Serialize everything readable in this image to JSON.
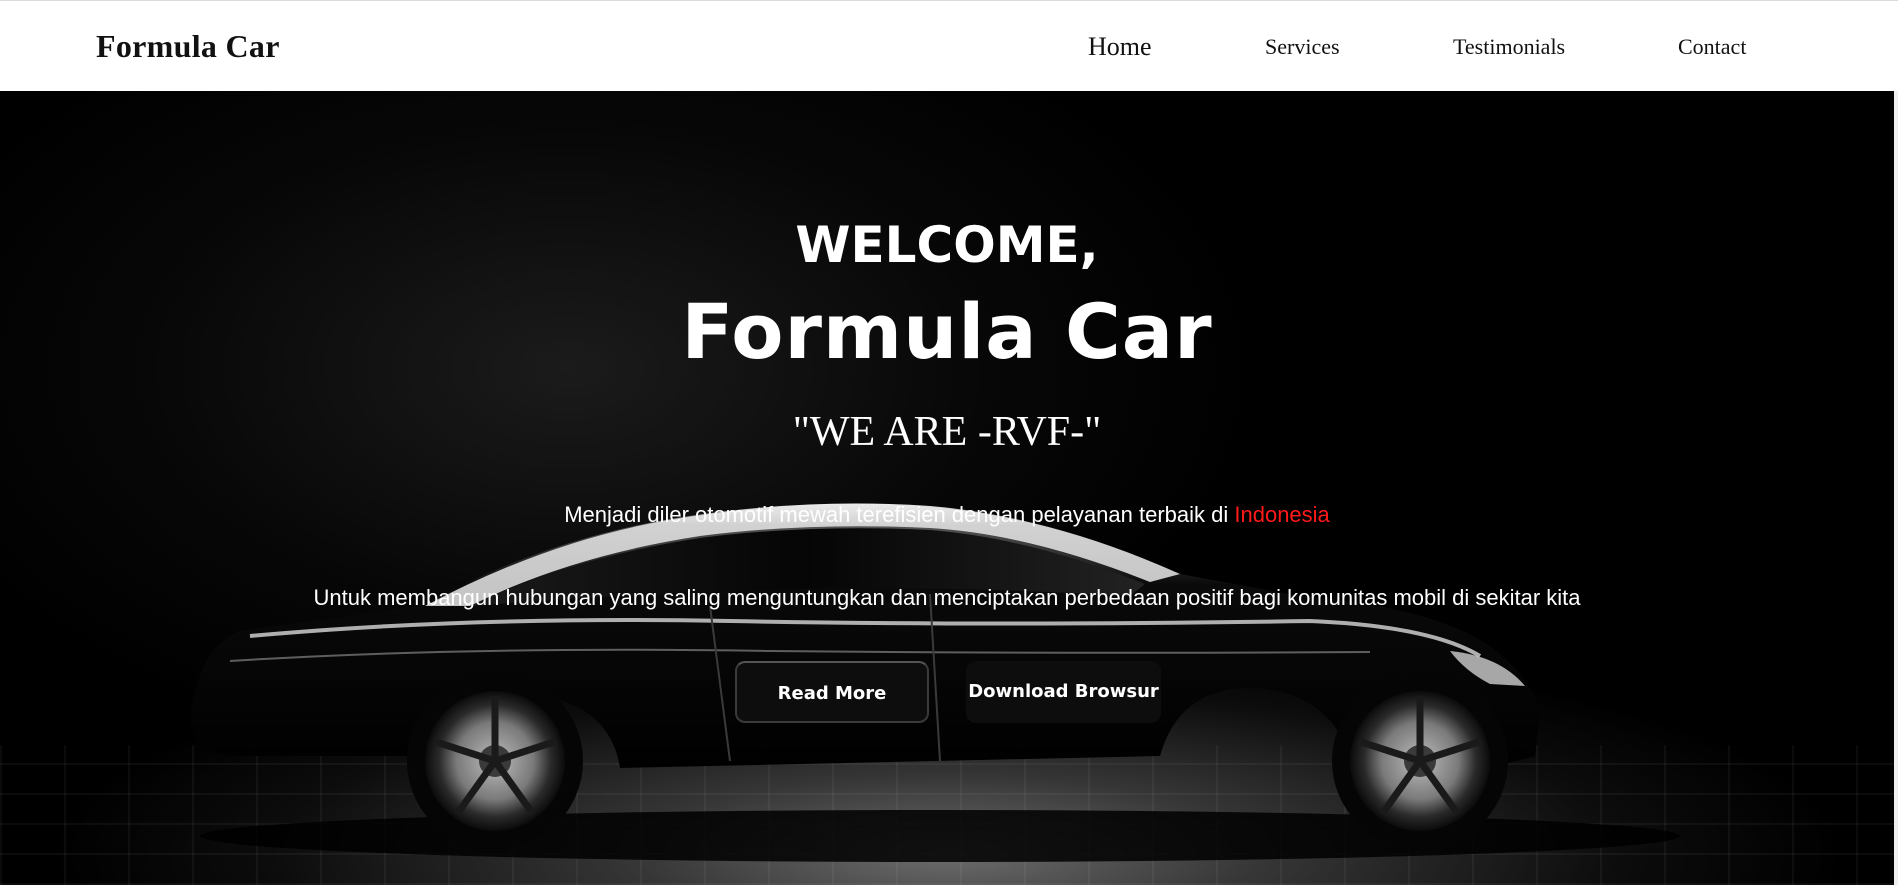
{
  "navbar": {
    "brand": "Formula Car",
    "links": [
      {
        "label": "Home"
      },
      {
        "label": "Services"
      },
      {
        "label": "Testimonials"
      },
      {
        "label": "Contact"
      }
    ]
  },
  "hero": {
    "welcome": "WELCOME,",
    "title": "Formula Car",
    "motto": "\"WE ARE -RVF-\"",
    "tagline_text": "Menjadi diler otomotif mewah terefisien dengan pelayanan terbaik di ",
    "tagline_highlight": "Indonesia",
    "mission": "Untuk membangun hubungan yang saling menguntungkan dan menciptakan perbedaan positif bagi komunitas mobil di sekitar kita",
    "buttons": {
      "read_more": "Read More",
      "download": "Download Browsur"
    }
  },
  "colors": {
    "highlight": "#ff1a1a",
    "hero_background": "#000000",
    "button_background": "#0d0d0d",
    "navbar_background": "#ffffff"
  }
}
